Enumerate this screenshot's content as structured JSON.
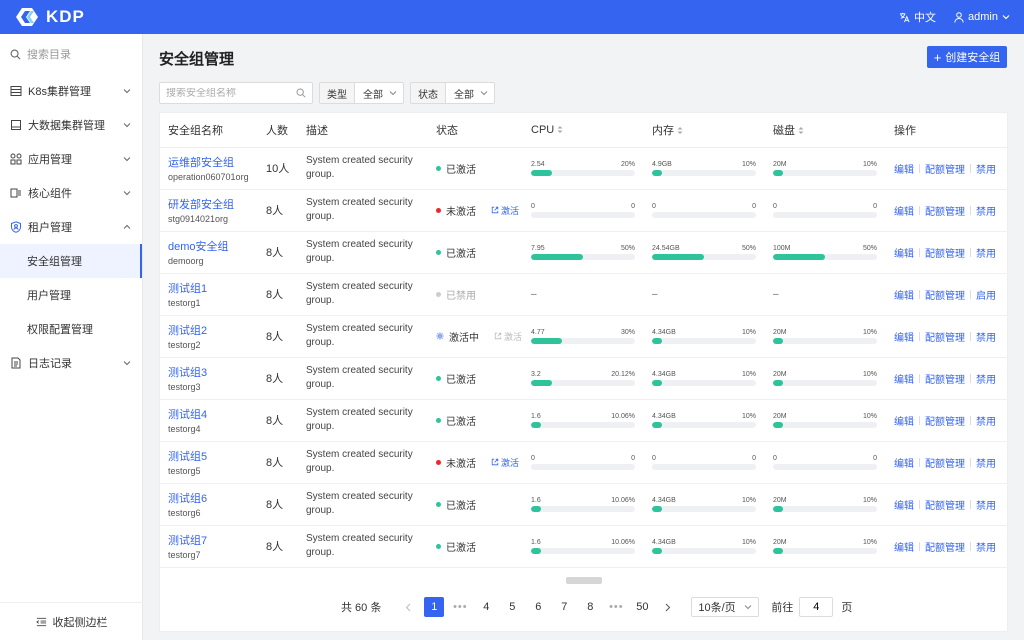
{
  "app": {
    "logo_text": "KDP"
  },
  "topbar": {
    "language": "中文",
    "user": "admin"
  },
  "sidebar": {
    "search_label": "搜索目录",
    "menu": [
      {
        "label": "K8s集群管理",
        "icon": "server-icon"
      },
      {
        "label": "大数据集群管理",
        "icon": "cluster-icon"
      },
      {
        "label": "应用管理",
        "icon": "apps-icon"
      },
      {
        "label": "核心组件",
        "icon": "component-icon"
      },
      {
        "label": "租户管理",
        "icon": "tenant-icon",
        "expanded": true
      },
      {
        "label": "日志记录",
        "icon": "log-icon"
      }
    ],
    "tenant_sub": [
      "安全组管理",
      "用户管理",
      "权限配置管理"
    ],
    "active_sub": "安全组管理",
    "collapse_label": "收起侧边栏"
  },
  "main": {
    "title": "安全组管理",
    "create_button": "创建安全组",
    "search_placeholder": "搜索安全组名称",
    "filters": [
      {
        "label": "类型",
        "value": "全部"
      },
      {
        "label": "状态",
        "value": "全部"
      }
    ],
    "columns": [
      "安全组名称",
      "人数",
      "描述",
      "状态",
      "CPU",
      "内存",
      "磁盘",
      "操作"
    ],
    "ops_labels": {
      "edit": "编辑",
      "quota": "配额管理"
    },
    "activate_label": "激活",
    "rows": [
      {
        "name": "运维部安全组",
        "org": "operation060701org",
        "count": "10人",
        "desc": "System created security group.",
        "status": "已激活",
        "status_color": "#2ec39a",
        "activate": "",
        "cpu": {
          "value": "2.54",
          "pct": "20%",
          "fill": 0.2
        },
        "mem": {
          "value": "4.9GB",
          "pct": "10%",
          "fill": 0.1
        },
        "disk": {
          "value": "20M",
          "pct": "10%",
          "fill": 0.1
        },
        "toggle": "禁用"
      },
      {
        "name": "研发部安全组",
        "org": "stg0914021org",
        "count": "8人",
        "desc": "System created security group.",
        "status": "未激活",
        "status_color": "#f5222d",
        "activate": "enabled",
        "cpu": {
          "value": "0",
          "pct": "0",
          "fill": 0
        },
        "mem": {
          "value": "0",
          "pct": "0",
          "fill": 0
        },
        "disk": {
          "value": "0",
          "pct": "0",
          "fill": 0
        },
        "toggle": "禁用"
      },
      {
        "name": "demo安全组",
        "org": "demoorg",
        "count": "8人",
        "desc": "System created security group.",
        "status": "已激活",
        "status_color": "#2ec39a",
        "activate": "",
        "cpu": {
          "value": "7.95",
          "pct": "50%",
          "fill": 0.5
        },
        "mem": {
          "value": "24.54GB",
          "pct": "50%",
          "fill": 0.5
        },
        "disk": {
          "value": "100M",
          "pct": "50%",
          "fill": 0.5
        },
        "toggle": "禁用"
      },
      {
        "name": "测试组1",
        "org": "testorg1",
        "count": "8人",
        "desc": "System created security group.",
        "status": "已禁用",
        "status_color": "#cccccc",
        "activate": "",
        "cpu": null,
        "mem": null,
        "disk": null,
        "toggle": "启用"
      },
      {
        "name": "测试组2",
        "org": "testorg2",
        "count": "8人",
        "desc": "System created security group.",
        "status": "激活中",
        "status_color": "#3464f0",
        "activate": "disabled",
        "cpu": {
          "value": "4.77",
          "pct": "30%",
          "fill": 0.3
        },
        "mem": {
          "value": "4.34GB",
          "pct": "10%",
          "fill": 0.1
        },
        "disk": {
          "value": "20M",
          "pct": "10%",
          "fill": 0.1
        },
        "toggle": "禁用"
      },
      {
        "name": "测试组3",
        "org": "testorg3",
        "count": "8人",
        "desc": "System created security group.",
        "status": "已激活",
        "status_color": "#2ec39a",
        "activate": "",
        "cpu": {
          "value": "3.2",
          "pct": "20.12%",
          "fill": 0.2012
        },
        "mem": {
          "value": "4.34GB",
          "pct": "10%",
          "fill": 0.1
        },
        "disk": {
          "value": "20M",
          "pct": "10%",
          "fill": 0.1
        },
        "toggle": "禁用"
      },
      {
        "name": "测试组4",
        "org": "testorg4",
        "count": "8人",
        "desc": "System created security group.",
        "status": "已激活",
        "status_color": "#2ec39a",
        "activate": "",
        "cpu": {
          "value": "1.6",
          "pct": "10.06%",
          "fill": 0.1006
        },
        "mem": {
          "value": "4.34GB",
          "pct": "10%",
          "fill": 0.1
        },
        "disk": {
          "value": "20M",
          "pct": "10%",
          "fill": 0.1
        },
        "toggle": "禁用"
      },
      {
        "name": "测试组5",
        "org": "testorg5",
        "count": "8人",
        "desc": "System created security group.",
        "status": "未激活",
        "status_color": "#f5222d",
        "activate": "enabled",
        "cpu": {
          "value": "0",
          "pct": "0",
          "fill": 0
        },
        "mem": {
          "value": "0",
          "pct": "0",
          "fill": 0
        },
        "disk": {
          "value": "0",
          "pct": "0",
          "fill": 0
        },
        "toggle": "禁用"
      },
      {
        "name": "测试组6",
        "org": "testorg6",
        "count": "8人",
        "desc": "System created security group.",
        "status": "已激活",
        "status_color": "#2ec39a",
        "activate": "",
        "cpu": {
          "value": "1.6",
          "pct": "10.06%",
          "fill": 0.1006
        },
        "mem": {
          "value": "4.34GB",
          "pct": "10%",
          "fill": 0.1
        },
        "disk": {
          "value": "20M",
          "pct": "10%",
          "fill": 0.1
        },
        "toggle": "禁用"
      },
      {
        "name": "测试组7",
        "org": "testorg7",
        "count": "8人",
        "desc": "System created security group.",
        "status": "已激活",
        "status_color": "#2ec39a",
        "activate": "",
        "cpu": {
          "value": "1.6",
          "pct": "10.06%",
          "fill": 0.1006
        },
        "mem": {
          "value": "4.34GB",
          "pct": "10%",
          "fill": 0.1
        },
        "disk": {
          "value": "20M",
          "pct": "10%",
          "fill": 0.1
        },
        "toggle": "禁用"
      }
    ],
    "pagination": {
      "total": "共 60 条",
      "pages": [
        "1",
        "•••",
        "4",
        "5",
        "6",
        "7",
        "8",
        "•••",
        "50"
      ],
      "current": "1",
      "page_size": "10条/页",
      "goto_label": "前往",
      "goto_value": "4",
      "page_unit": "页"
    }
  },
  "colors": {
    "accent": "#3464f0",
    "success": "#2ec39a",
    "danger": "#f5222d"
  }
}
